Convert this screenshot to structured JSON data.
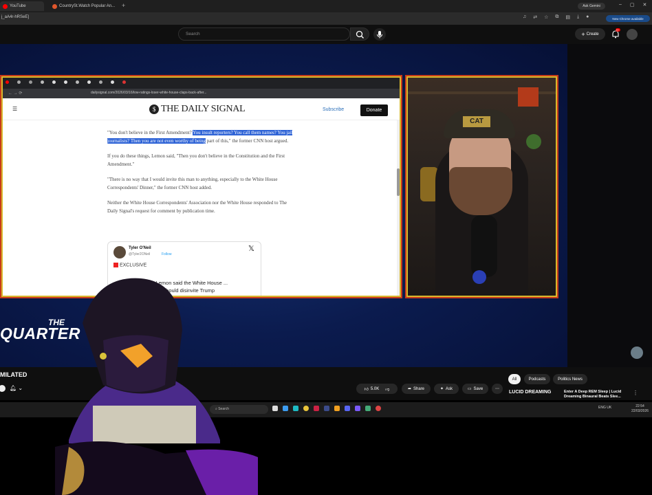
{
  "browser": {
    "tabs": [
      {
        "label": "YouTube",
        "color": "#ff0000"
      },
      {
        "label": "CountrySt.Watch Popular An...",
        "color": "#e0562c"
      }
    ],
    "new_tab": "+",
    "address": "j_aA4r-hRSeE]",
    "ask_gemini": "Ask Gemini",
    "update_badge": "New Chrome available"
  },
  "youtube": {
    "search_placeholder": "Search",
    "create_label": "Create",
    "notif_count": "9+",
    "channel_name": "MILATED",
    "likes": "5.0K",
    "share": "Share",
    "ask": "Ask",
    "save": "Save",
    "chips": [
      "All",
      "Podcasts",
      "Politics News"
    ],
    "rec_thumb_text": "LUCID DREAMING",
    "rec_title": "Enter A Deep REM Sleep | Lucid Dreaming Binaural Beats Slee..."
  },
  "video": {
    "overlay_line1": "THE",
    "overlay_line2": "QUARTER",
    "inner_browser": {
      "address": "dailysignal.com/2026/03/16/low-ratings-loser-white-house-claps-back-after...",
      "site_logo": "THE DAILY SIGNAL",
      "subscribe": "Subscribe",
      "donate": "Donate",
      "paragraphs": [
        {
          "pre": "\"You don't believe in the First Amendment?",
          "highlight": "You insult reporters? You call them names? You jail journalists? Then you are not even worthy of being",
          "post": "part of this,\" the former CNN host argued."
        },
        {
          "text": "If you do these things, Lemon said, \"Then you don't believe in the Constitution and the First Amendment.\""
        },
        {
          "text": "\"There is no way that I would invite this man to anything, especially to the White House Correspondents' Dinner,\" the former CNN host added."
        },
        {
          "text": "Neither the White House Correspondents' Association nor the White House responded to The Daily Signal's request for comment by publication time."
        }
      ],
      "tweet": {
        "name": "Tyler O'Neil",
        "handle": "@Tyler2ONeil",
        "follow": "Follow",
        "label": "EXCLUSIVE",
        "body": "...y, Don Lemon said the White House ... Association should disinvite Trump"
      }
    },
    "cam_hat_text": "CAT"
  },
  "taskbar": {
    "search": "Search",
    "time": "22:54",
    "date": "22/03/2026",
    "lang": "ENG UK"
  },
  "colors": {
    "frame_gold": "#d8b92d",
    "frame_red": "#c83a1a",
    "yt_red": "#ff0000",
    "highlight": "#2e63d6"
  }
}
